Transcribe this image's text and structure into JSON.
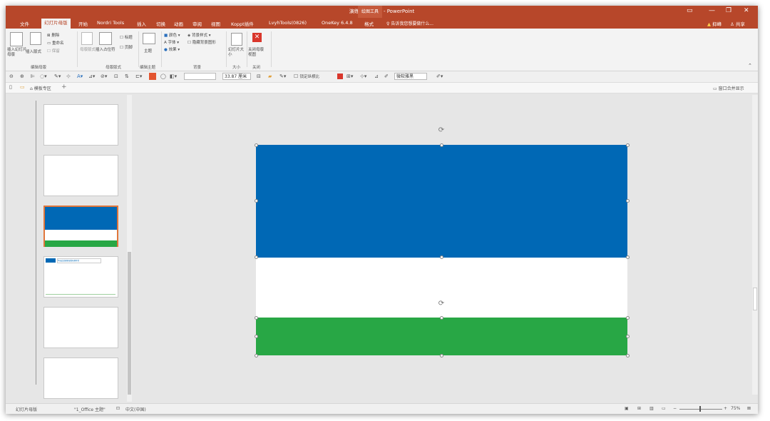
{
  "titlebar": {
    "title": "演练文稿.pptx - PowerPoint",
    "context_tab": "绘图工具"
  },
  "tabs": {
    "file": "文件",
    "slide_master": "幻灯片母版",
    "home": "开始",
    "nordri": "Nordri Tools",
    "insert": "插入",
    "transitions": "切换",
    "animations": "动画",
    "review": "审阅",
    "view": "视图",
    "koppt": "Koppt插件",
    "lvyh": "LvyhTools(0826)",
    "onekey": "OneKey 6.4.8",
    "format": "格式",
    "tell_me": "告诉我您想要做什么...",
    "warning": "抑峰",
    "share": "共享"
  },
  "ribbon": {
    "insert_slide_master": "插入幻灯片母版",
    "insert_layout": "插入版式",
    "delete": "删除",
    "rename": "重命名",
    "preserve": "保留",
    "group_edit_master": "编辑母版",
    "master_layout": "母版版式",
    "insert_placeholder": "插入占位符",
    "title_check": "标题",
    "footer_check": "页脚",
    "group_master_layout": "母版版式",
    "themes": "主题",
    "group_edit_theme": "编辑主题",
    "colors": "颜色",
    "fonts": "字体",
    "effects": "效果",
    "bg_styles": "背景样式",
    "hide_bg": "隐藏背景图形",
    "group_background": "背景",
    "slide_size": "幻灯片大小",
    "group_size": "大小",
    "close_master": "关闭母版视图",
    "group_close": "关闭"
  },
  "toolbar": {
    "size_value": "33.87 厘米",
    "lock_ratio": "锁定纵横比",
    "font_name": "微软雅黑"
  },
  "filetabs": {
    "template_area": "模板专区",
    "window_merge": "窗口合并显示"
  },
  "thumbnails": {
    "title_text": "单击此处编辑母版标题样式"
  },
  "slide": {
    "colors": {
      "blue": "#0068b5",
      "white": "#ffffff",
      "green": "#28a745",
      "accent": "#b7472a",
      "selected_border": "#e0763b"
    }
  },
  "statusbar": {
    "view": "幻灯片母版",
    "theme": "\"1_Office 主题\"",
    "language": "中文(中国)",
    "zoom": "75%"
  }
}
